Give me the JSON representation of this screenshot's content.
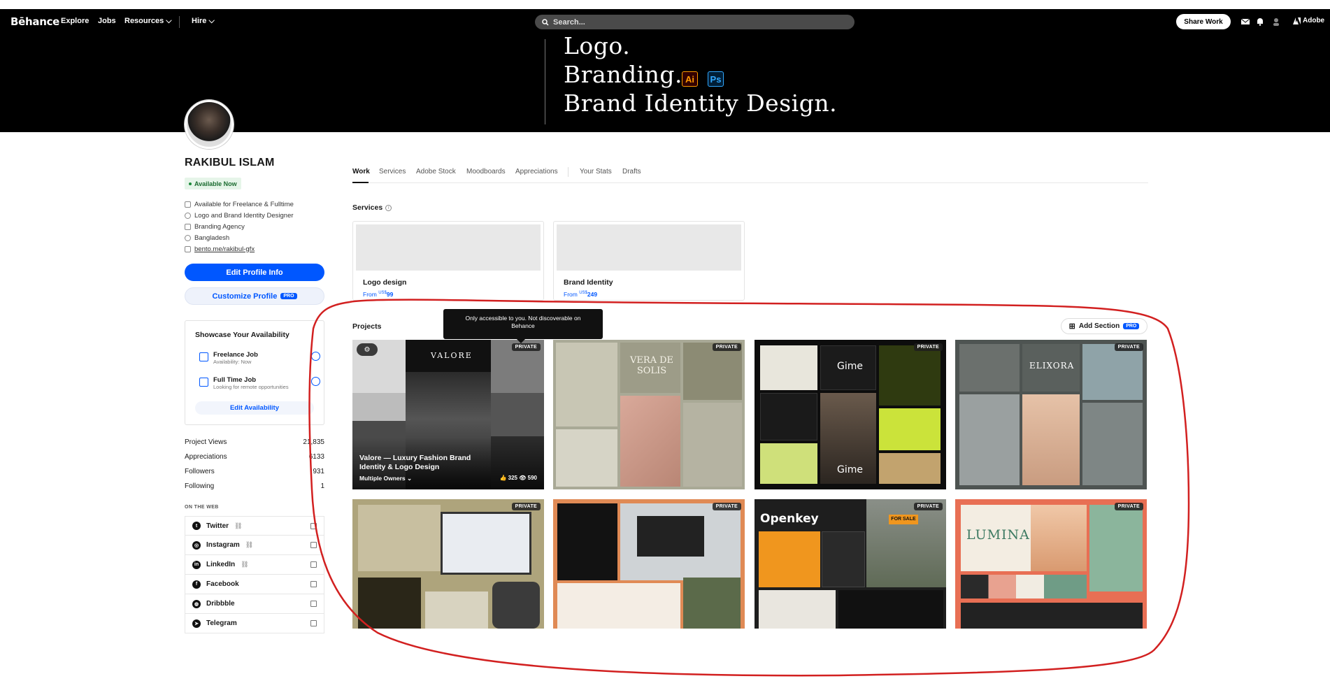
{
  "nav": {
    "logo": "Bēhance",
    "links": [
      "Explore",
      "Jobs",
      "Resources ⌵",
      "Hire ⌵"
    ],
    "search_placeholder": "Search...",
    "share_work": "Share Work",
    "adobe": "Adobe"
  },
  "banner": {
    "lines": [
      "Logo.",
      "Branding.",
      "Brand Identity Design."
    ],
    "badge_ai": "Ai",
    "badge_ps": "Ps"
  },
  "profile": {
    "name": "RAKIBUL ISLAM",
    "status": "Available Now",
    "info": [
      {
        "icon": "briefcase-icon",
        "text": "Available for Freelance & Fulltime"
      },
      {
        "icon": "clock-icon",
        "text": "Logo and Brand Identity Designer"
      },
      {
        "icon": "building-icon",
        "text": "Branding Agency"
      },
      {
        "icon": "globe-icon",
        "text": "Bangladesh"
      },
      {
        "icon": "link-icon",
        "text": "bento.me/rakibul-gfx"
      }
    ],
    "edit_button": "Edit Profile Info",
    "customize_button": "Customize Profile",
    "pro": "PRO"
  },
  "availability": {
    "title": "Showcase Your Availability",
    "items": [
      {
        "label": "Freelance Job",
        "sub": "Availability: Now"
      },
      {
        "label": "Full Time Job",
        "sub": "Looking for remote opportunities"
      }
    ],
    "button": "Edit Availability"
  },
  "stats": [
    {
      "label": "Project Views",
      "value": "21,835"
    },
    {
      "label": "Appreciations",
      "value": "6133"
    },
    {
      "label": "Followers",
      "value": "931"
    },
    {
      "label": "Following",
      "value": "1"
    }
  ],
  "on_the_web": {
    "heading": "ON THE WEB",
    "links": [
      {
        "label": "Twitter",
        "verified": true
      },
      {
        "label": "Instagram",
        "verified": true
      },
      {
        "label": "LinkedIn",
        "verified": true
      },
      {
        "label": "Facebook",
        "verified": false
      },
      {
        "label": "Dribbble",
        "verified": false
      },
      {
        "label": "Telegram",
        "verified": false
      }
    ]
  },
  "tabs": [
    "Work",
    "Services",
    "Adobe Stock",
    "Moodboards",
    "Appreciations",
    "Your Stats",
    "Drafts"
  ],
  "services": {
    "label": "Services",
    "cards": [
      {
        "title": "Logo design",
        "from": "From",
        "currency": "US$",
        "price": "99"
      },
      {
        "title": "Brand Identity",
        "from": "From",
        "currency": "US$",
        "price": "249"
      }
    ]
  },
  "projects": {
    "label": "Projects",
    "tooltip": "Only accessible to you. Not discoverable on Behance",
    "add_section": "Add Section",
    "private_label": "PRIVATE",
    "first": {
      "title": "Valore — Luxury Fashion Brand Identity & Logo Design",
      "owners": "Multiple Owners ⌄",
      "likes": "325",
      "views": "590"
    },
    "wordmarks": {
      "valore": "VALORE",
      "vera": "VERA DE SOLIS",
      "gime": "Gime",
      "elixora": "ELIXORA",
      "openkey": "Openkey",
      "forsale": "FOR SALE",
      "lumina": "LUMINA"
    }
  },
  "colors": {
    "accent": "#0057ff",
    "annotation": "#d22020"
  }
}
